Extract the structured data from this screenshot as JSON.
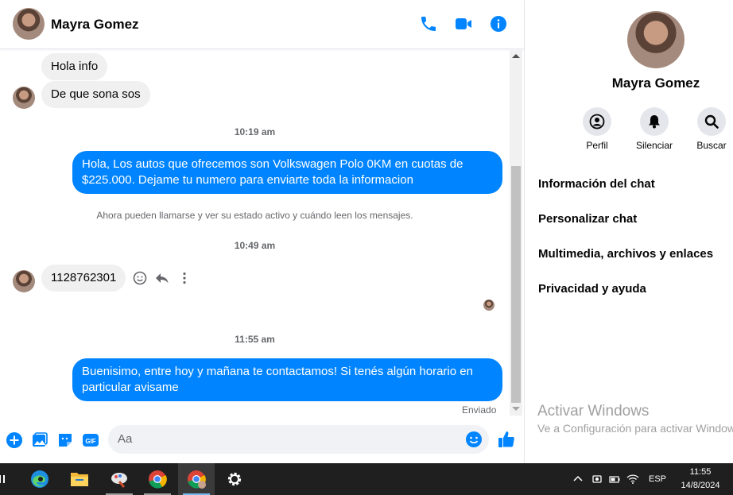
{
  "header": {
    "name": "Mayra Gomez"
  },
  "messages": {
    "in1": "Hola info",
    "in2": "De que sona sos",
    "time1": "10:19 am",
    "out1": "Hola, Los autos que ofrecemos son Volkswagen Polo 0KM en cuotas de $225.000. Dejame tu numero para enviarte toda la informacion",
    "system": "Ahora pueden llamarse y ver su estado activo y cuándo leen los mensajes.",
    "time2": "10:49 am",
    "in3": "1128762301",
    "time3": "11:55 am",
    "out2": "Buenisimo, entre hoy y mañana te contactamos! Si tenés algún horario en particular avisame",
    "status": "Enviado"
  },
  "composer": {
    "placeholder": "Aa"
  },
  "info": {
    "name": "Mayra Gomez",
    "actions": [
      "Perfil",
      "Silenciar",
      "Buscar"
    ],
    "menu": [
      "Información del chat",
      "Personalizar chat",
      "Multimedia, archivos y enlaces",
      "Privacidad y ayuda"
    ]
  },
  "watermark": {
    "line1": "Activar Windows",
    "line2": "Ve a Configuración para activar Windows."
  },
  "taskbar": {
    "lang": "ESP",
    "time": "11:55",
    "date": "14/8/2024"
  },
  "colors": {
    "accent": "#0084ff",
    "bubble_in": "#f0f0f0",
    "taskbar": "#1f1f1f"
  }
}
